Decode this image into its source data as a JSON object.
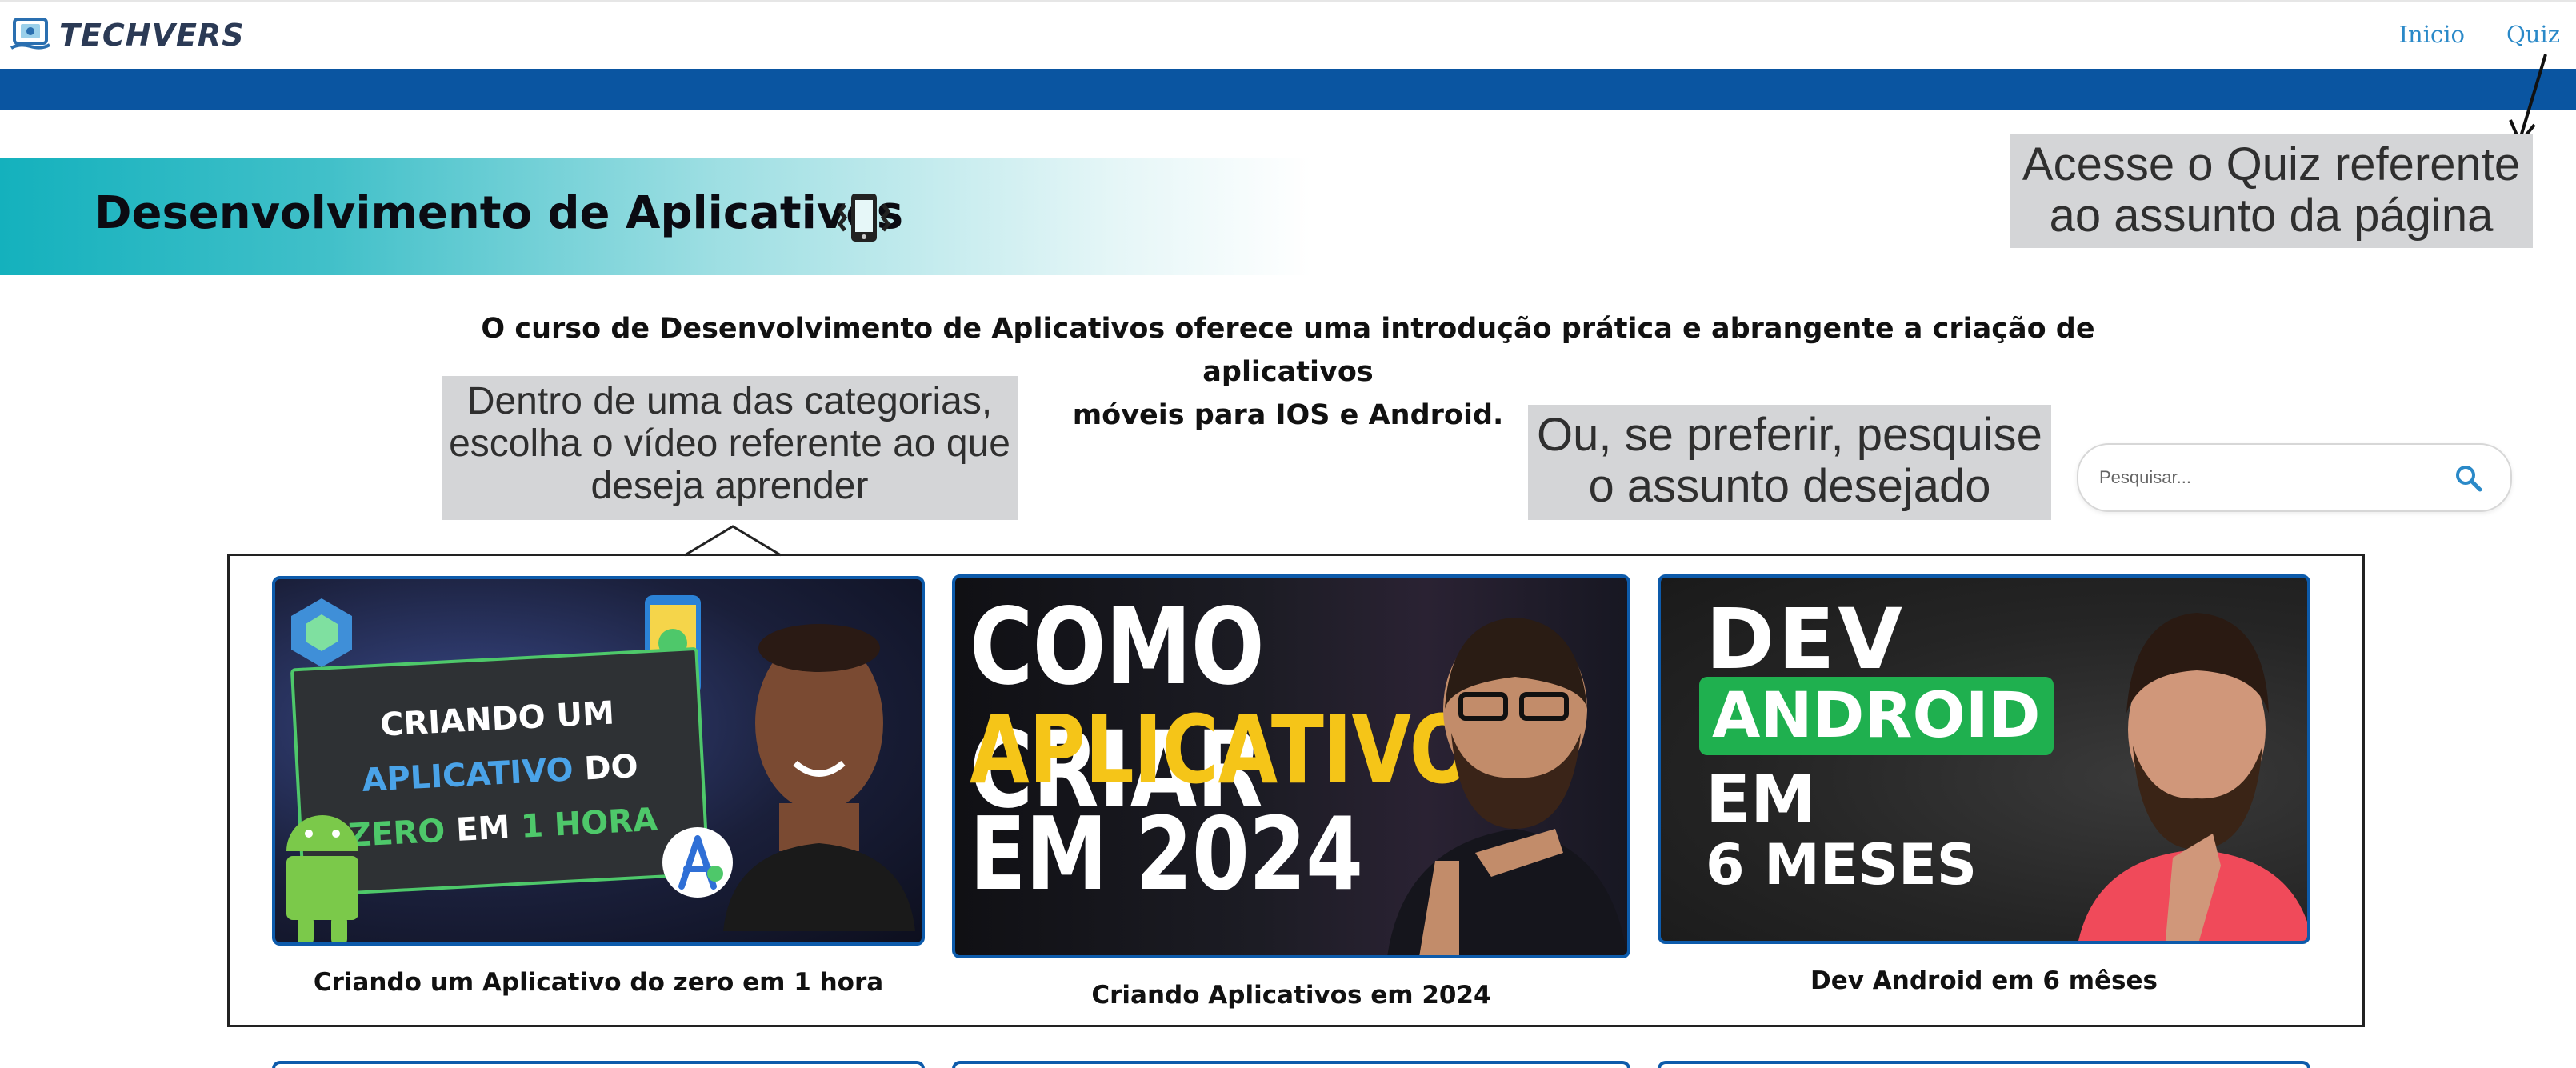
{
  "header": {
    "brand": "TECHVERS",
    "nav": [
      {
        "label": "Inicio"
      },
      {
        "label": "Quiz"
      }
    ]
  },
  "banner": {
    "title": "Desenvolvimento de Aplicativos"
  },
  "callouts": {
    "quiz_line1": "Acesse o Quiz referente",
    "quiz_line2": "ao assunto da página",
    "video_line1": "Dentro de uma das categorias,",
    "video_line2": "escolha o vídeo referente ao que",
    "video_line3": "deseja aprender",
    "search_line1": "Ou, se preferir, pesquise",
    "search_line2": "o assunto desejado"
  },
  "intro": {
    "line1": "O curso de Desenvolvimento de Aplicativos oferece uma introdução prática e abrangente a criação de aplicativos",
    "line2": "móveis para IOS e Android."
  },
  "search": {
    "placeholder": "Pesquisar..."
  },
  "videos": [
    {
      "caption": "Criando um Aplicativo do zero em 1 hora",
      "thumb_line1": "CRIANDO UM",
      "thumb_line2a": "APLICATIVO",
      "thumb_line2b": " DO",
      "thumb_line3a": "ZERO",
      "thumb_line3b": " EM ",
      "thumb_line3c": "1 HORA"
    },
    {
      "caption": "Criando Aplicativos em 2024",
      "thumb_line1": "COMO CRIAR",
      "thumb_line2": "APLICATIVOS",
      "thumb_line3": "EM 2024"
    },
    {
      "caption": "Dev Android em 6 mêses",
      "thumb_line1": "DEV",
      "thumb_line2": "ANDROID",
      "thumb_line3": "EM",
      "thumb_line4": "6 MESES"
    }
  ],
  "colors": {
    "nav_link": "#2a89c8",
    "bluebar": "#0a55a1",
    "banner_start": "#14b1bd",
    "callout_bg": "#d4d5d7",
    "card_border": "#0d5bab",
    "android_green": "#1fb04f",
    "yellow": "#f5c518"
  },
  "icons": {
    "logo": "techvers-logo-icon",
    "banner": "phone-vibrate-icon",
    "search": "search-icon"
  }
}
